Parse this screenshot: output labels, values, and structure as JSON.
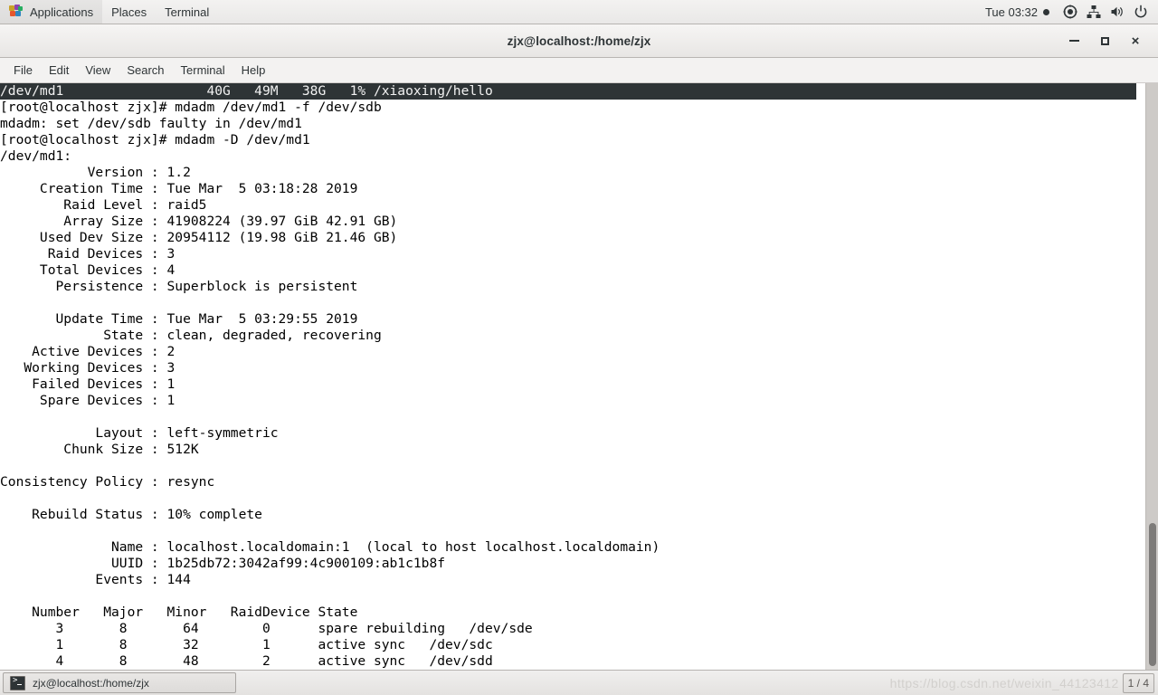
{
  "top_panel": {
    "applications_label": "Applications",
    "places_label": "Places",
    "terminal_label": "Terminal",
    "clock": "Tue 03:32",
    "tray_icons": [
      "record-indicator-icon",
      "network-icon",
      "volume-icon",
      "power-icon"
    ]
  },
  "window": {
    "title": "zjx@localhost:/home/zjx",
    "buttons": {
      "minimize": "minimize-button",
      "maximize": "maximize-button",
      "close": "×"
    }
  },
  "menubar": {
    "items": [
      {
        "label": "File"
      },
      {
        "label": "Edit"
      },
      {
        "label": "View"
      },
      {
        "label": "Search"
      },
      {
        "label": "Terminal"
      },
      {
        "label": "Help"
      }
    ]
  },
  "terminal": {
    "highlighted_line": "/dev/md1                  40G   49M   38G   1% /xiaoxing/hello",
    "lines": [
      "[root@localhost zjx]# mdadm /dev/md1 -f /dev/sdb",
      "mdadm: set /dev/sdb faulty in /dev/md1",
      "[root@localhost zjx]# mdadm -D /dev/md1",
      "/dev/md1:",
      "           Version : 1.2",
      "     Creation Time : Tue Mar  5 03:18:28 2019",
      "        Raid Level : raid5",
      "        Array Size : 41908224 (39.97 GiB 42.91 GB)",
      "     Used Dev Size : 20954112 (19.98 GiB 21.46 GB)",
      "      Raid Devices : 3",
      "     Total Devices : 4",
      "       Persistence : Superblock is persistent",
      "",
      "       Update Time : Tue Mar  5 03:29:55 2019",
      "             State : clean, degraded, recovering",
      "    Active Devices : 2",
      "   Working Devices : 3",
      "    Failed Devices : 1",
      "     Spare Devices : 1",
      "",
      "            Layout : left-symmetric",
      "        Chunk Size : 512K",
      "",
      "Consistency Policy : resync",
      "",
      "    Rebuild Status : 10% complete",
      "",
      "              Name : localhost.localdomain:1  (local to host localhost.localdomain)",
      "              UUID : 1b25db72:3042af99:4c900109:ab1c1b8f",
      "            Events : 144",
      "",
      "    Number   Major   Minor   RaidDevice State",
      "       3       8       64        0      spare rebuilding   /dev/sde",
      "       1       8       32        1      active sync   /dev/sdc",
      "       4       8       48        2      active sync   /dev/sdd"
    ]
  },
  "taskbar": {
    "window_button_label": "zjx@localhost:/home/zjx",
    "watermark": "https://blog.csdn.net/weixin_44123412",
    "workspace_indicator": "1 / 4"
  }
}
